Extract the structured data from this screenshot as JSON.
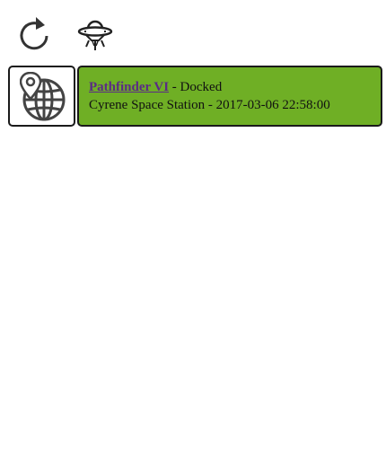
{
  "toolbar": {
    "refresh_icon": "refresh-icon",
    "ship_icon": "spaceship-icon"
  },
  "map": {
    "icon": "globe-location-icon"
  },
  "status": {
    "ship_name": "Pathfinder VI",
    "separator": " - ",
    "state": "Docked",
    "location": "Cyrene Space Station",
    "separator2": " - ",
    "timestamp": "2017-03-06 22:58:00",
    "card_color": "#6faf25",
    "link_color": "#5a2b86"
  }
}
